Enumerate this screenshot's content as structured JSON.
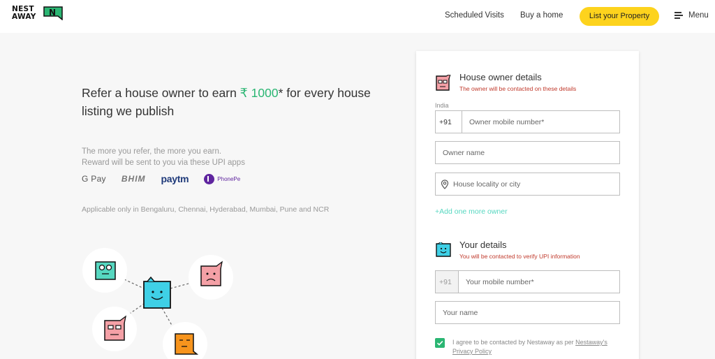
{
  "header": {
    "logo_line1": "NEST",
    "logo_line2": "AWAY",
    "logo_mark_letter": "N",
    "nav": {
      "scheduled_visits": "Scheduled Visits",
      "buy_home": "Buy a home",
      "list_property": "List your Property",
      "menu": "Menu"
    },
    "colors": {
      "accent_yellow": "#fdd31d",
      "logo_green": "#2bb673"
    }
  },
  "hero": {
    "headline_pre": "Refer a house owner to earn ",
    "headline_amount": "₹ 1000",
    "headline_post": "* for every house listing we publish",
    "sub_line1": "The more you refer, the more you earn.",
    "sub_line2": "Reward will be sent to you via these UPI apps",
    "upi_apps": {
      "gpay": "G Pay",
      "bhim": "BHIM",
      "paytm": "paytm",
      "phonepe": "PhonePe"
    },
    "applicable": "Applicable only in Bengaluru, Chennai, Hyderabad, Mumbai, Pune and NCR"
  },
  "form": {
    "owner_section": {
      "title": "House owner details",
      "subtitle": "The owner will be contacted on these details",
      "country_label": "India",
      "phone_prefix": "+91",
      "phone_placeholder": "Owner mobile number*",
      "name_placeholder": "Owner name",
      "locality_placeholder": "House locality or city",
      "add_owner": "+Add one more owner"
    },
    "your_section": {
      "title": "Your details",
      "subtitle": "You will be contacted to verify UPI information",
      "phone_prefix": "+91",
      "phone_placeholder": "Your mobile number*",
      "name_placeholder": "Your name"
    },
    "consent": {
      "text": "I agree to be contacted by Nestaway as per ",
      "link": "Nestaway's Privacy Policy",
      "checked": true
    }
  }
}
